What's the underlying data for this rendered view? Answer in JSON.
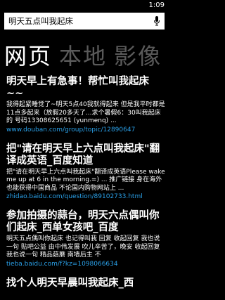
{
  "status": {
    "time": "1:09"
  },
  "search": {
    "query": "明天五点叫我起床"
  },
  "pivot": {
    "items": [
      "网页",
      "本地",
      "影像"
    ]
  },
  "results": [
    {
      "title": "明天早上有急事！帮忙叫我起床~~",
      "snippet": "我得起紧睡觉了~明天5点40我就得起来 但是我平时都是11点多起来（放假20多天了...求个暑假6：30叫我起床的 号码13308625651 (yunmenq) ...",
      "url": "www.douban.com/group/topic/12890647"
    },
    {
      "title": "把\"请在明天早上六点叫我起床\"翻译成英语_百度知道",
      "snippet": "把\"请在明天早上六点叫我起床\"翻译成英语Please wake me up at 6 in the morning.=) ... 推广链接 身在海外也能获得中国商品 不论国内购物网站上 ...",
      "url": "zhidao.baidu.com/question/89102733.html"
    },
    {
      "title": "参加拍摄的蒜台，明天六点偶叫你们起床_西单女孩吧_百度",
      "snippet": "明天五点偶叫你起床 也记得叫我 回复 收起回复 我也说一句 贴吧公益 由中伟发展 吹儿辛苦了，晚安 收起回复 我也说一句 精品菇蘑 南墙后主 不",
      "url": "tieba.baidu.com/f?kz=1098066634"
    },
    {
      "title": "找个人明天早晨叫我起床_西",
      "snippet": "",
      "url": ""
    }
  ]
}
